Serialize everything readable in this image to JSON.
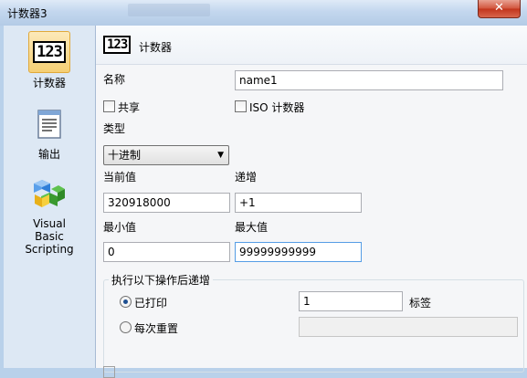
{
  "window": {
    "title": "计数器3",
    "close_label": "✕"
  },
  "nav": {
    "items": [
      {
        "label": "计数器",
        "icon": "counter-123-icon",
        "icon_text": "123",
        "selected": true
      },
      {
        "label": "输出",
        "icon": "output-document-icon"
      },
      {
        "label": "Visual Basic Scripting",
        "icon": "vbs-cubes-icon"
      }
    ]
  },
  "header": {
    "icon_text": "123",
    "title": "计数器"
  },
  "form": {
    "name_label": "名称",
    "name_value": "name1",
    "shared_label": "共享",
    "iso_label": "ISO 计数器",
    "type_label": "类型",
    "type_value": "十进制",
    "current_label": "当前值",
    "current_value": "320918000",
    "increment_label": "递增",
    "increment_value": "+1",
    "min_label": "最小值",
    "min_value": "0",
    "max_label": "最大值",
    "max_value": "99999999999"
  },
  "increment_group": {
    "title": "执行以下操作后递增",
    "printed_label": "已打印",
    "printed_selected": true,
    "printed_count": "1",
    "tag_label": "标签",
    "reset_label": "每次重置",
    "reset_value": ""
  },
  "colors": {
    "accent": "#569de5",
    "nav_selected": "#f5cf74",
    "close": "#c2351c"
  }
}
